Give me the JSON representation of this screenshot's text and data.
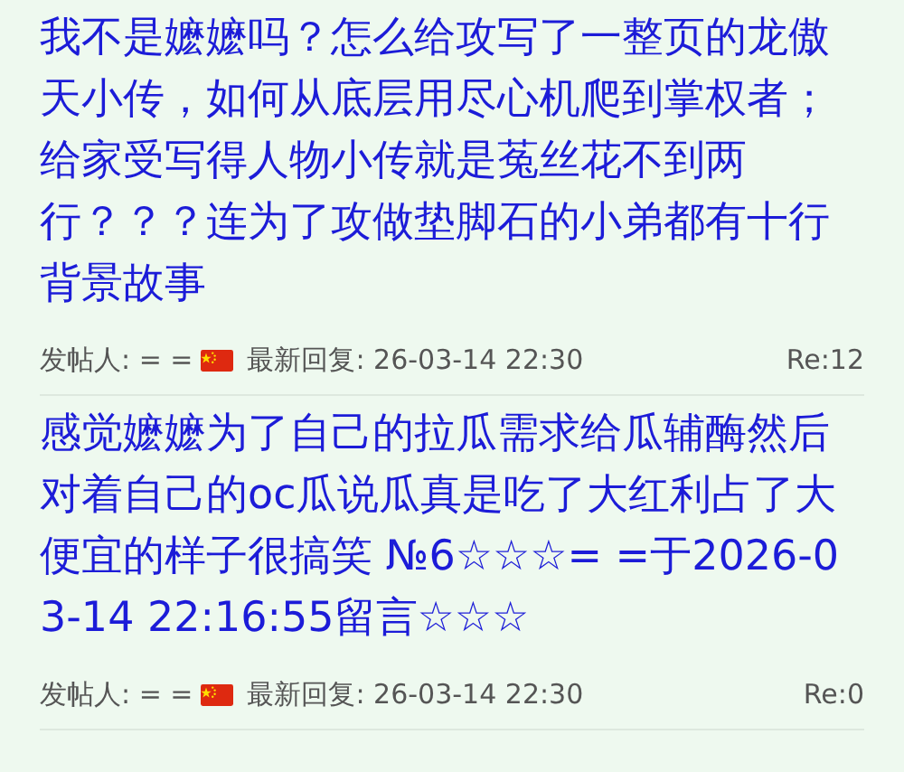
{
  "posts": [
    {
      "title": "我不是嬷嬷吗？怎么给攻写了一整页的龙傲天小传，如何从底层用尽心机爬到掌权者；给家受写得人物小传就是菟丝花不到两行？？？连为了攻做垫脚石的小弟都有十行背景故事",
      "author_label": "发帖人: = =",
      "latest_label": "最新回复: 26-03-14 22:30",
      "replies": "Re:12"
    },
    {
      "title": "感觉嬷嬷为了自己的拉瓜需求给瓜辅酶然后对着自己的oc瓜说瓜真是吃了大红利占了大便宜的样子很搞笑 №6☆☆☆= =于2026-03-14 22:16:55留言☆☆☆",
      "author_label": "发帖人: = =",
      "latest_label": "最新回复: 26-03-14 22:30",
      "replies": "Re:0"
    }
  ]
}
